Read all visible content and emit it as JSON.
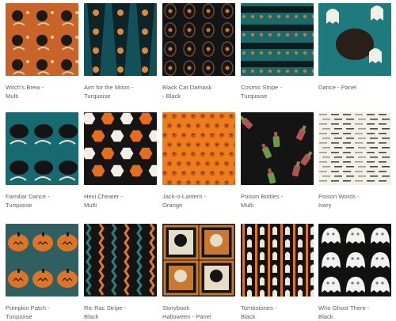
{
  "products": [
    {
      "name": "Witch's Brew -",
      "variant": "Multi",
      "pattern": "witch",
      "colors": [
        "#c8642a",
        "#1c1a16",
        "#e3c79a"
      ]
    },
    {
      "name": "Aim for the Moon -",
      "variant": "Turquoise",
      "pattern": "moon",
      "colors": [
        "#12505a",
        "#0f1f22",
        "#d98a3a"
      ]
    },
    {
      "name": "Black Cat Damask",
      "variant": "- Black",
      "pattern": "damask",
      "colors": [
        "#141414",
        "#d27a2c",
        "#6a4a3a"
      ]
    },
    {
      "name": "Cosmic Stripe -",
      "variant": "Turquoise",
      "pattern": "cosmic",
      "colors": [
        "#1a6a6c",
        "#0c1b1c",
        "#c6783a"
      ]
    },
    {
      "name": "Dance - Panel",
      "variant": "",
      "pattern": "dance",
      "colors": [
        "#1f7a80",
        "#2a1e18",
        "#f2efe6"
      ]
    },
    {
      "name": "Familiar Dance -",
      "variant": "Turquoise",
      "pattern": "familiar",
      "colors": [
        "#176a70",
        "#141414",
        "#e9e3d2"
      ]
    },
    {
      "name": "Hexi Cheater -",
      "variant": "Multi",
      "pattern": "hexi",
      "colors": [
        "#151515",
        "#e46d1e",
        "#f4efe5"
      ]
    },
    {
      "name": "Jack-o-Lantern -",
      "variant": "Orange",
      "pattern": "jack",
      "colors": [
        "#ef7c1d",
        "#c25a14",
        "#2a1a0e"
      ]
    },
    {
      "name": "Poison Bottles -",
      "variant": "Multi",
      "pattern": "bottles",
      "colors": [
        "#141414",
        "#6f9a4a",
        "#b35454"
      ]
    },
    {
      "name": "Poison Words -",
      "variant": "Ivory",
      "pattern": "words",
      "colors": [
        "#f3f0e8",
        "#4a4a44",
        "#9a9a8e"
      ]
    },
    {
      "name": "Pumpkin Patch -",
      "variant": "Turquoise",
      "pattern": "pumpkin",
      "colors": [
        "#2f5f60",
        "#de7526",
        "#1b1b16"
      ]
    },
    {
      "name": "Ric Rac Stripe -",
      "variant": "Black",
      "pattern": "ricrac",
      "colors": [
        "#141414",
        "#e0782a",
        "#2f7c7c"
      ]
    },
    {
      "name": "Storybook",
      "variant": "Halloween - Panel",
      "pattern": "storybook",
      "colors": [
        "#141414",
        "#c9792f",
        "#e7dcc8"
      ]
    },
    {
      "name": "Tombstones -",
      "variant": "Black",
      "pattern": "tomb",
      "colors": [
        "#121212",
        "#dd7428",
        "#efe7d8"
      ]
    },
    {
      "name": "Who Ghost There -",
      "variant": "Black",
      "pattern": "ghost",
      "colors": [
        "#111111",
        "#f2f2ee",
        "#777777"
      ]
    }
  ]
}
